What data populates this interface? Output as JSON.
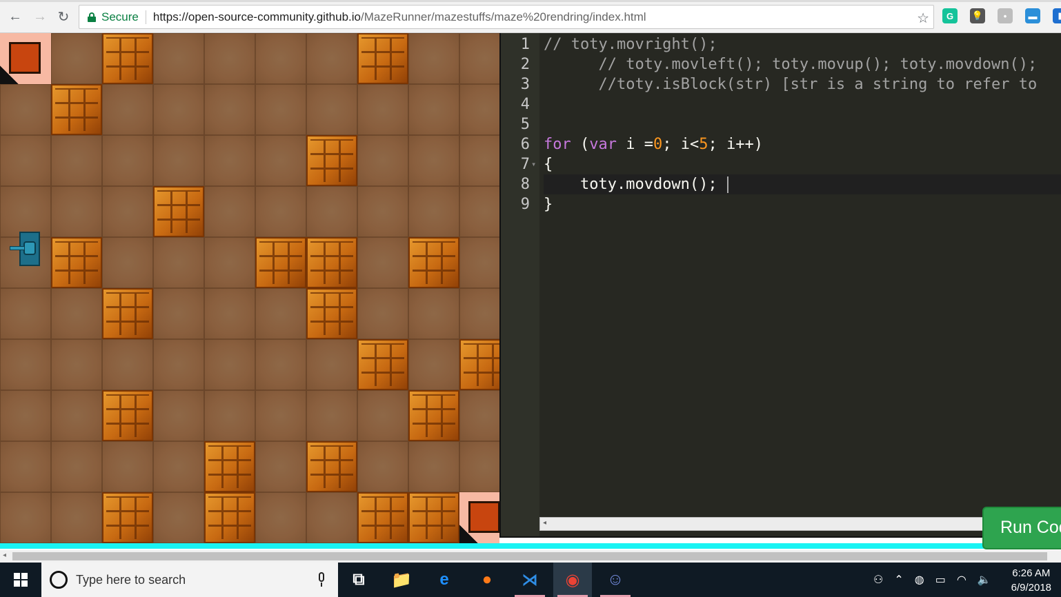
{
  "browser": {
    "secure_label": "Secure",
    "url_host": "https://open-source-community.github.io",
    "url_path": "/MazeRunner/mazestuffs/maze%20rendring/index.html",
    "nav": {
      "back": "←",
      "forward": "→",
      "reload": "↻",
      "star": "☆"
    },
    "extensions": [
      {
        "name": "grammarly-icon",
        "glyph": "G",
        "color": "#15c39a"
      },
      {
        "name": "bulb-extension-icon",
        "glyph": "💡",
        "color": "#555555"
      },
      {
        "name": "chat-extension-icon",
        "glyph": "•",
        "color": "#bdbdbd"
      },
      {
        "name": "window-extension-icon",
        "glyph": "▬",
        "color": "#2b8fd9"
      },
      {
        "name": "blue-extension-icon",
        "glyph": "▮",
        "color": "#1e6fd0"
      }
    ]
  },
  "maze": {
    "grid_columns": 10,
    "grid_rows": 10,
    "bricks": [
      [
        0,
        2
      ],
      [
        0,
        7
      ],
      [
        1,
        1
      ],
      [
        2,
        6
      ],
      [
        3,
        3
      ],
      [
        4,
        1
      ],
      [
        4,
        5
      ],
      [
        4,
        6
      ],
      [
        4,
        8
      ],
      [
        5,
        2
      ],
      [
        5,
        6
      ],
      [
        6,
        7
      ],
      [
        6,
        9
      ],
      [
        7,
        2
      ],
      [
        7,
        8
      ],
      [
        8,
        4
      ],
      [
        8,
        6
      ],
      [
        9,
        2
      ],
      [
        9,
        4
      ],
      [
        9,
        7
      ],
      [
        9,
        8
      ]
    ],
    "portals": [
      [
        0,
        0
      ],
      [
        9,
        9
      ]
    ],
    "tank": {
      "row": 4,
      "col": 0,
      "facing": "left"
    },
    "colors": {
      "brick": "#c86a12",
      "floor": "#8b6040",
      "portal": "#f7b9a3",
      "tank": "#1d6f8a",
      "bottom_bar": "#19f3f3"
    }
  },
  "editor": {
    "lines": [
      {
        "n": "1",
        "indent": "",
        "segments": [
          {
            "t": "// toty.movright();",
            "c": "comment"
          }
        ]
      },
      {
        "n": "2",
        "indent": "      ",
        "segments": [
          {
            "t": "// toty.movleft(); toty.movup(); toty.movdown();",
            "c": "comment"
          }
        ]
      },
      {
        "n": "3",
        "indent": "      ",
        "segments": [
          {
            "t": "//toty.isBlock(str) [str is a string to refer to",
            "c": "comment"
          }
        ]
      },
      {
        "n": "4",
        "indent": "",
        "segments": []
      },
      {
        "n": "5",
        "indent": "",
        "segments": []
      },
      {
        "n": "6",
        "indent": "",
        "segments": [
          {
            "t": "for",
            "c": "kw"
          },
          {
            "t": " (",
            "c": ""
          },
          {
            "t": "var",
            "c": "kw"
          },
          {
            "t": " i =",
            "c": ""
          },
          {
            "t": "0",
            "c": "num"
          },
          {
            "t": "; i<",
            "c": ""
          },
          {
            "t": "5",
            "c": "num"
          },
          {
            "t": "; i++)",
            "c": ""
          }
        ]
      },
      {
        "n": "7",
        "indent": "",
        "fold": true,
        "segments": [
          {
            "t": "{",
            "c": ""
          }
        ]
      },
      {
        "n": "8",
        "indent": "    ",
        "active": true,
        "segments": [
          {
            "t": "toty.movdown();",
            "c": ""
          }
        ]
      },
      {
        "n": "9",
        "indent": "",
        "segments": [
          {
            "t": "}",
            "c": ""
          }
        ]
      }
    ],
    "run_button_label": "Run Code"
  },
  "taskbar": {
    "search_placeholder": "Type here to search",
    "time": "6:26 AM",
    "date": "6/9/2018",
    "apps": [
      {
        "name": "task-view-icon",
        "glyph": "⧉",
        "color": "#ffffff"
      },
      {
        "name": "file-explorer-icon",
        "glyph": "📁",
        "color": "#f2c14e"
      },
      {
        "name": "edge-icon",
        "glyph": "e",
        "color": "#1e90ff"
      },
      {
        "name": "firefox-icon",
        "glyph": "●",
        "color": "#ff7a18"
      },
      {
        "name": "vscode-icon",
        "glyph": "⋊",
        "color": "#2f8ee6"
      },
      {
        "name": "chrome-icon",
        "glyph": "◉",
        "color": "#ea4335"
      },
      {
        "name": "discord-icon",
        "glyph": "☺",
        "color": "#7289da"
      }
    ],
    "tray": [
      {
        "name": "people-icon",
        "glyph": "⚇"
      },
      {
        "name": "chevron-up-icon",
        "glyph": "⌃"
      },
      {
        "name": "network-icon",
        "glyph": "◍"
      },
      {
        "name": "battery-icon",
        "glyph": "▭"
      },
      {
        "name": "wifi-icon",
        "glyph": "◠"
      },
      {
        "name": "volume-icon",
        "glyph": "🔈"
      }
    ]
  }
}
